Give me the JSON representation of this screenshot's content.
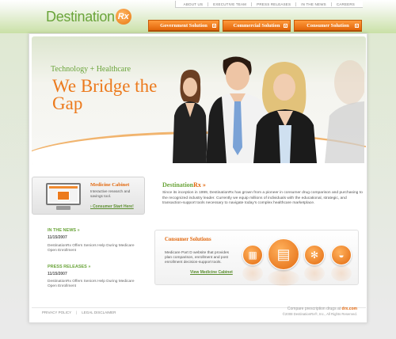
{
  "top_links": [
    "ABOUT US",
    "EXECUTIVE TEAM",
    "PRESS RELEASES",
    "IN THE NEWS",
    "CAREERS"
  ],
  "logo": {
    "text": "Destination",
    "rx": "Rx"
  },
  "nav": [
    "Government Solution",
    "Commercial Solution",
    "Consumer Solution"
  ],
  "hero": {
    "subtitle": "Technology + Healthcare",
    "title": "We Bridge the Gap"
  },
  "medicine_cabinet": {
    "title": "Medicine Cabinet",
    "description": "Interactive research and savings tool.",
    "link": "Consumer Start Here!"
  },
  "intro": {
    "title_a": "Destination",
    "title_b": "Rx",
    "arrow": "»",
    "text": "Since its inception in 1999, DestinationRx has grown from a pioneer in consumer drug comparison and purchasing to the recognized industry leader. Currently we equip millions of individuals with the educational, strategic, and transaction-support tools necessary to navigate today's complex healthcare marketplace."
  },
  "news": {
    "heading": "IN THE NEWS",
    "date": "11/15/2007",
    "text": "DestinationRx Offers Seniors Help During Medicare Open Enrollment"
  },
  "press": {
    "heading": "PRESS RELEASES",
    "date": "11/15/2007",
    "text": "DestinationRx Offers Seniors Help During Medicare Open Enrollment"
  },
  "consumer_solutions": {
    "title": "Consumer Solutions",
    "text": "Medicare Part D website that provides plan comparison, enrollment and post enrollment decision-support tools.",
    "link": "View Medicine Cabinet",
    "icons": [
      "calendar-icon",
      "calculator-icon",
      "pills-icon",
      "mortar-pestle-icon"
    ]
  },
  "footer": {
    "links": [
      "PRIVACY POLICY",
      "LEGAL DISCLAIMER"
    ],
    "compare_text": "Compare prescription drugs at",
    "compare_site": "drx.com",
    "copyright": "©2008 DestinationRx®, Inc., All Rights Reserved."
  },
  "colors": {
    "brand_green": "#6aa43a",
    "brand_orange": "#ec7a1d"
  }
}
